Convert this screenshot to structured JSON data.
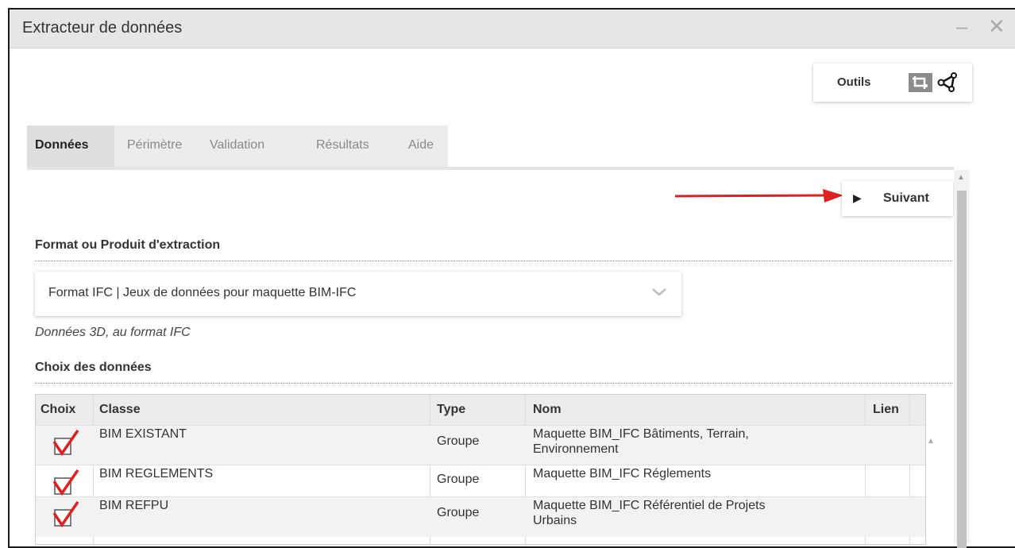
{
  "window": {
    "title": "Extracteur de données",
    "minimize_label": "–",
    "close_label": "✕"
  },
  "toolbar": {
    "tools_label": "Outils",
    "icons": [
      "crop-selection-icon",
      "share-network-icon"
    ]
  },
  "tabs": [
    {
      "label": "Données",
      "active": true
    },
    {
      "label": "Périmètre",
      "active": false
    },
    {
      "label": "Validation",
      "active": false
    },
    {
      "label": "Résultats",
      "active": false
    },
    {
      "label": "Aide",
      "active": false
    }
  ],
  "next_button": {
    "label": "Suivant"
  },
  "format_section": {
    "title": "Format ou Produit d'extraction",
    "selected": "Format IFC | Jeux de données pour maquette BIM-IFC",
    "caption": "Données 3D, au format IFC"
  },
  "data_section": {
    "title": "Choix des données",
    "columns": [
      "Choix",
      "Classe",
      "Type",
      "Nom",
      "Lien"
    ],
    "rows": [
      {
        "checked": true,
        "classe": "BIM EXISTANT",
        "type": "Groupe",
        "nom_line1": "Maquette BIM_IFC Bâtiments, Terrain,",
        "nom_line2": "Environnement",
        "lien": ""
      },
      {
        "checked": true,
        "classe": "BIM REGLEMENTS",
        "type": "Groupe",
        "nom_line1": "Maquette BIM_IFC Réglements",
        "nom_line2": "",
        "lien": ""
      },
      {
        "checked": true,
        "classe": "BIM REFPU",
        "type": "Groupe",
        "nom_line1": "Maquette BIM_IFC Référentiel de Projets",
        "nom_line2": "Urbains",
        "lien": ""
      }
    ]
  },
  "colors": {
    "annotation_arrow": "#e02020",
    "check_mark": "#e02020",
    "titlebar_bg": "#e6e6e6"
  }
}
